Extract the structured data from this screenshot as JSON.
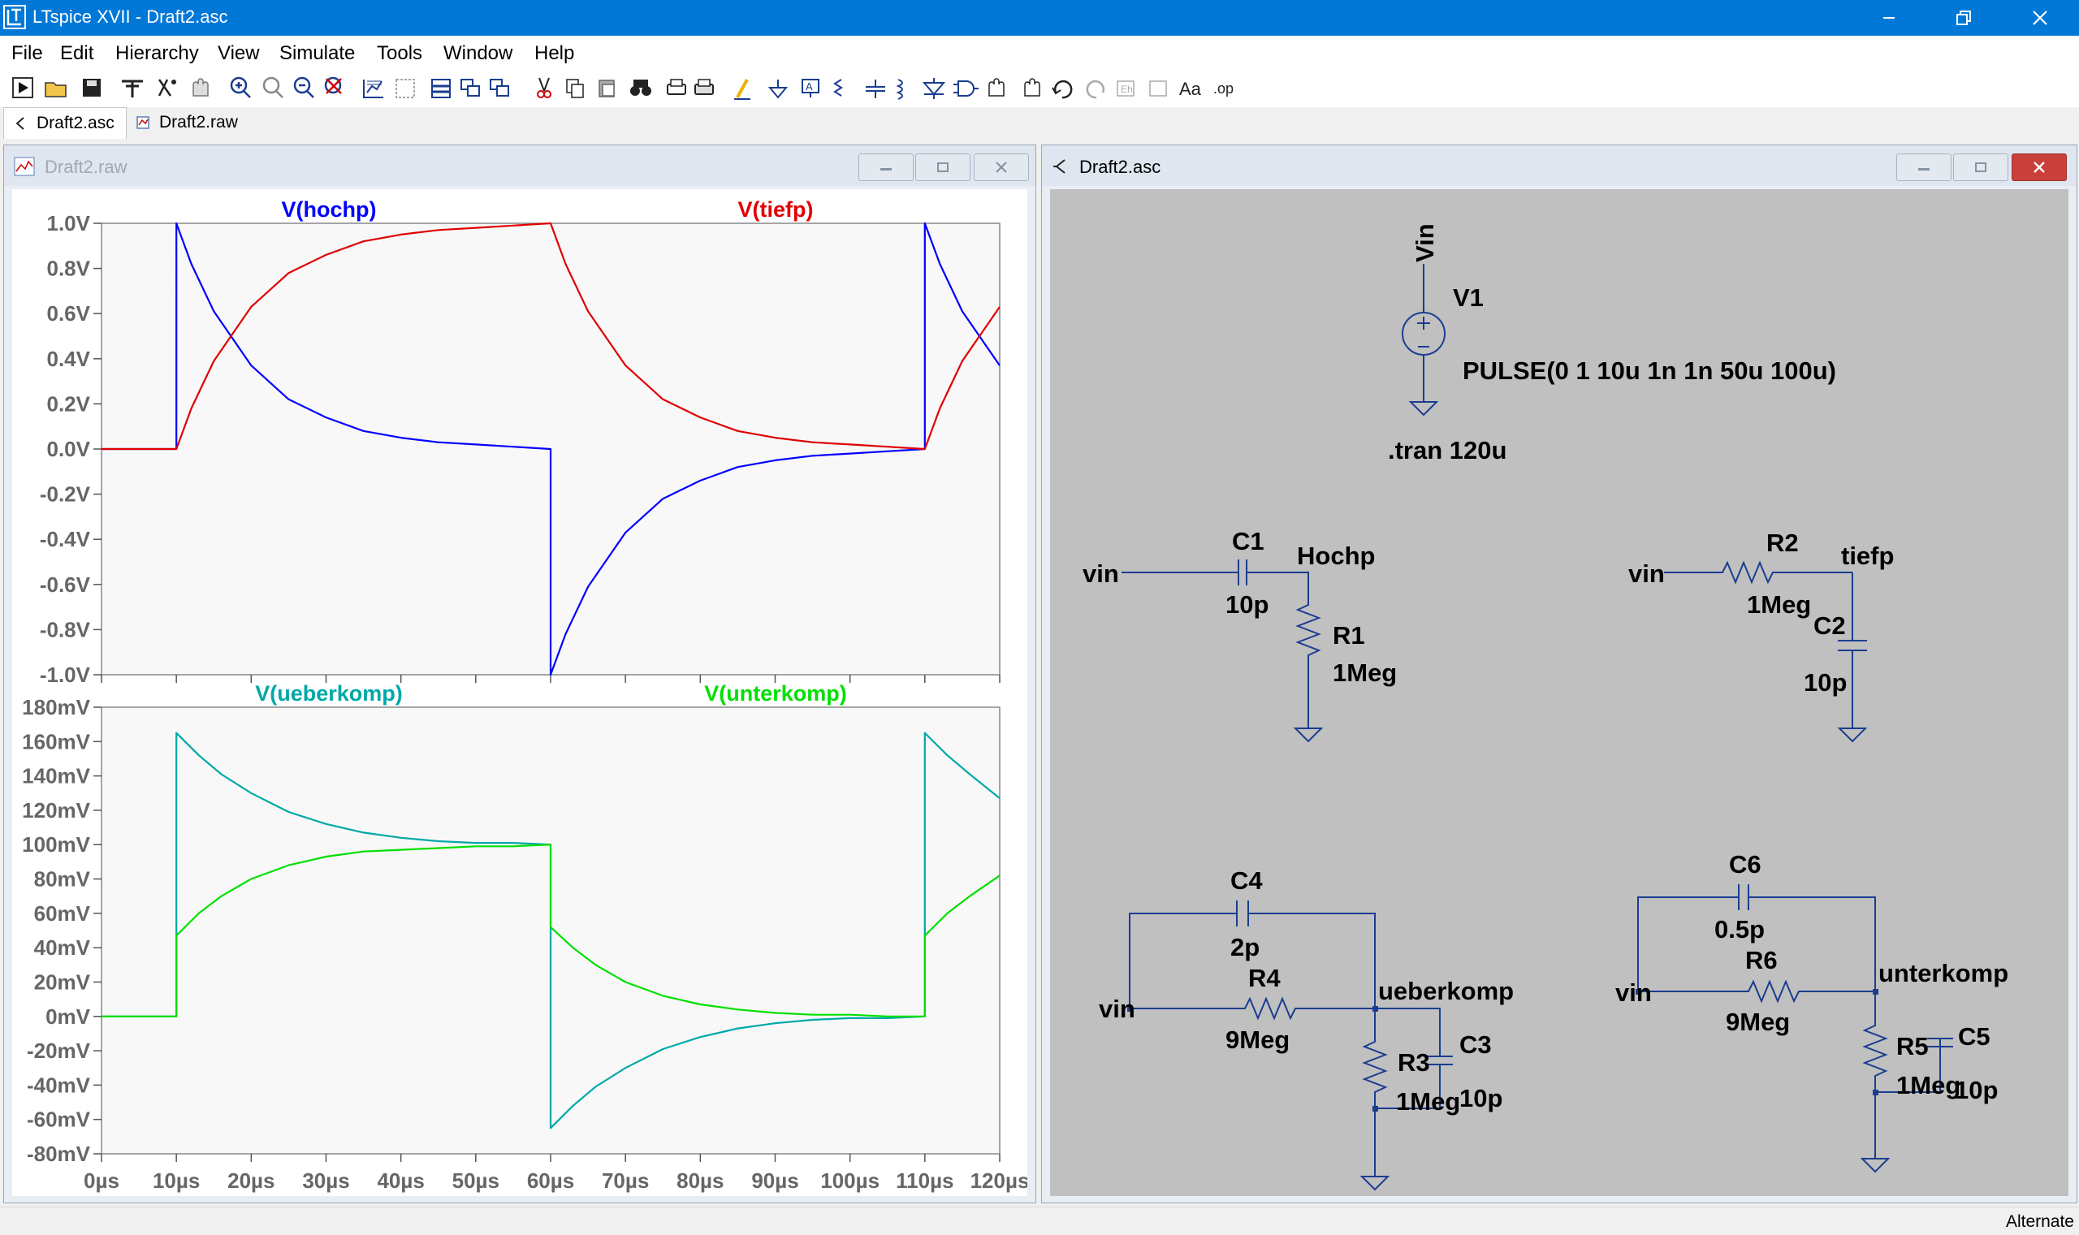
{
  "window": {
    "title": "LTspice XVII - Draft2.asc"
  },
  "menu": [
    "File",
    "Edit",
    "Hierarchy",
    "View",
    "Simulate",
    "Tools",
    "Window",
    "Help"
  ],
  "tabs": [
    {
      "label": "Draft2.asc"
    },
    {
      "label": "Draft2.raw"
    }
  ],
  "waveform_window": {
    "title": "Draft2.raw",
    "chart_data": [
      {
        "type": "line",
        "series": [
          {
            "name": "V(hochp)",
            "color": "#0000ff",
            "points": [
              [
                0,
                0
              ],
              [
                10,
                0
              ],
              [
                10,
                1.0
              ],
              [
                12,
                0.82
              ],
              [
                15,
                0.61
              ],
              [
                20,
                0.37
              ],
              [
                25,
                0.22
              ],
              [
                30,
                0.14
              ],
              [
                35,
                0.08
              ],
              [
                40,
                0.05
              ],
              [
                45,
                0.03
              ],
              [
                50,
                0.02
              ],
              [
                55,
                0.01
              ],
              [
                60,
                0.0
              ],
              [
                60,
                -1.0
              ],
              [
                62,
                -0.82
              ],
              [
                65,
                -0.61
              ],
              [
                70,
                -0.37
              ],
              [
                75,
                -0.22
              ],
              [
                80,
                -0.14
              ],
              [
                85,
                -0.08
              ],
              [
                90,
                -0.05
              ],
              [
                95,
                -0.03
              ],
              [
                100,
                -0.02
              ],
              [
                105,
                -0.01
              ],
              [
                110,
                0.0
              ],
              [
                110,
                1.0
              ],
              [
                112,
                0.82
              ],
              [
                115,
                0.61
              ],
              [
                120,
                0.37
              ]
            ]
          },
          {
            "name": "V(tiefp)",
            "color": "#e00000",
            "points": [
              [
                0,
                0
              ],
              [
                10,
                0
              ],
              [
                12,
                0.18
              ],
              [
                15,
                0.39
              ],
              [
                20,
                0.63
              ],
              [
                25,
                0.78
              ],
              [
                30,
                0.86
              ],
              [
                35,
                0.92
              ],
              [
                40,
                0.95
              ],
              [
                45,
                0.97
              ],
              [
                50,
                0.98
              ],
              [
                55,
                0.99
              ],
              [
                60,
                1.0
              ],
              [
                62,
                0.82
              ],
              [
                65,
                0.61
              ],
              [
                70,
                0.37
              ],
              [
                75,
                0.22
              ],
              [
                80,
                0.14
              ],
              [
                85,
                0.08
              ],
              [
                90,
                0.05
              ],
              [
                95,
                0.03
              ],
              [
                100,
                0.02
              ],
              [
                105,
                0.01
              ],
              [
                110,
                0.0
              ],
              [
                112,
                0.18
              ],
              [
                115,
                0.39
              ],
              [
                120,
                0.63
              ]
            ]
          }
        ],
        "ylim": [
          -1.0,
          1.0
        ],
        "yticks": [
          "1.0V",
          "0.8V",
          "0.6V",
          "0.4V",
          "0.2V",
          "0.0V",
          "-0.2V",
          "-0.4V",
          "-0.6V",
          "-0.8V",
          "-1.0V"
        ],
        "xlim": [
          0,
          120
        ]
      },
      {
        "type": "line",
        "series": [
          {
            "name": "V(ueberkomp)",
            "color": "#00a8a8",
            "points": [
              [
                0,
                0
              ],
              [
                10,
                0
              ],
              [
                10,
                165
              ],
              [
                13,
                152
              ],
              [
                16,
                141
              ],
              [
                20,
                130
              ],
              [
                25,
                119
              ],
              [
                30,
                112
              ],
              [
                35,
                107
              ],
              [
                40,
                104
              ],
              [
                45,
                102
              ],
              [
                50,
                101
              ],
              [
                55,
                101
              ],
              [
                60,
                100
              ],
              [
                60,
                -65
              ],
              [
                63,
                -52
              ],
              [
                66,
                -41
              ],
              [
                70,
                -30
              ],
              [
                75,
                -19
              ],
              [
                80,
                -12
              ],
              [
                85,
                -7
              ],
              [
                90,
                -4
              ],
              [
                95,
                -2
              ],
              [
                100,
                -1
              ],
              [
                105,
                -1
              ],
              [
                110,
                0
              ],
              [
                110,
                165
              ],
              [
                113,
                152
              ],
              [
                116,
                141
              ],
              [
                120,
                127
              ]
            ]
          },
          {
            "name": "V(unterkomp)",
            "color": "#00e000",
            "points": [
              [
                0,
                0
              ],
              [
                10,
                0
              ],
              [
                10,
                47
              ],
              [
                13,
                60
              ],
              [
                16,
                70
              ],
              [
                20,
                80
              ],
              [
                25,
                88
              ],
              [
                30,
                93
              ],
              [
                35,
                96
              ],
              [
                40,
                97
              ],
              [
                45,
                98
              ],
              [
                50,
                99
              ],
              [
                55,
                99
              ],
              [
                60,
                100
              ],
              [
                60,
                52
              ],
              [
                63,
                40
              ],
              [
                66,
                30
              ],
              [
                70,
                20
              ],
              [
                75,
                12
              ],
              [
                80,
                7
              ],
              [
                85,
                4
              ],
              [
                90,
                2
              ],
              [
                95,
                1
              ],
              [
                100,
                1
              ],
              [
                105,
                0
              ],
              [
                110,
                0
              ],
              [
                110,
                47
              ],
              [
                113,
                60
              ],
              [
                116,
                70
              ],
              [
                120,
                82
              ]
            ]
          }
        ],
        "ylim": [
          -80,
          180
        ],
        "yticks": [
          "180mV",
          "160mV",
          "140mV",
          "120mV",
          "100mV",
          "80mV",
          "60mV",
          "40mV",
          "20mV",
          "0mV",
          "-20mV",
          "-40mV",
          "-60mV",
          "-80mV"
        ],
        "xticks": [
          "0µs",
          "10µs",
          "20µs",
          "30µs",
          "40µs",
          "50µs",
          "60µs",
          "70µs",
          "80µs",
          "90µs",
          "100µs",
          "110µs",
          "120µs"
        ],
        "xlim": [
          0,
          120
        ]
      }
    ]
  },
  "schematic_window": {
    "title": "Draft2.asc",
    "labels": {
      "vin_net": "Vin",
      "v1": "V1",
      "pulse": "PULSE(0 1 10u 1n 1n 50u 100u)",
      "tran": ".tran 120u",
      "c1": "C1",
      "c1_val": "10p",
      "hochp": "Hochp",
      "r1": "R1",
      "r1_val": "1Meg",
      "vin_a": "vin",
      "r2": "R2",
      "r2_val": "1Meg",
      "tiefp": "tiefp",
      "c2": "C2",
      "c2_val": "10p",
      "vin_b": "vin",
      "c4": "C4",
      "c4_val": "2p",
      "r4": "R4",
      "r4_val": "9Meg",
      "ueberkomp": "ueberkomp",
      "vin_c": "vin",
      "r3": "R3",
      "r3_val": "1Meg",
      "c3": "C3",
      "c3_val": "10p",
      "c6": "C6",
      "c6_val": "0.5p",
      "r6": "R6",
      "r6_val": "9Meg",
      "unterkomp": "unterkomp",
      "vin_d": "vin",
      "r5": "R5",
      "r5_val": "1Meg",
      "c5": "C5",
      "c5_val": "10p"
    }
  },
  "status": "Alternate"
}
